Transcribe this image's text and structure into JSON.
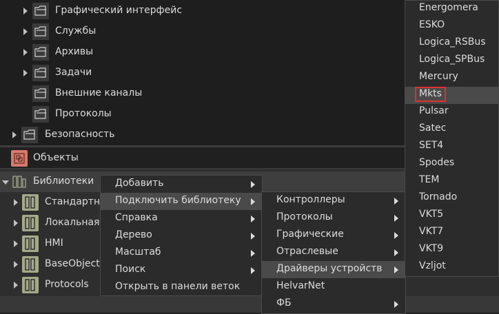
{
  "tree": {
    "items": [
      {
        "label": "Графический интерфейс"
      },
      {
        "label": "Службы"
      },
      {
        "label": "Архивы"
      },
      {
        "label": "Задачи"
      },
      {
        "label": "Внешние каналы"
      },
      {
        "label": "Протоколы"
      },
      {
        "label": "Безопасность"
      }
    ],
    "objects_label": "Объекты",
    "libraries_label": "Библиотеки",
    "libraries": [
      {
        "label": "Стандартна"
      },
      {
        "label": "Локальная"
      },
      {
        "label": "HMI"
      },
      {
        "label": "BaseObjects"
      },
      {
        "label": "Protocols"
      }
    ]
  },
  "context_menu": {
    "items": [
      {
        "label": "Добавить",
        "submenu": true
      },
      {
        "label": "Подключить библиотеку",
        "submenu": true,
        "highlighted": true
      },
      {
        "label": "Справка",
        "submenu": true
      },
      {
        "label": "Дерево",
        "submenu": true
      },
      {
        "label": "Масштаб",
        "submenu": true
      },
      {
        "label": "Поиск",
        "submenu": true
      },
      {
        "label": "Открыть в панели веток",
        "submenu": false
      }
    ]
  },
  "library_submenu": {
    "items": [
      {
        "label": "Контроллеры",
        "submenu": true
      },
      {
        "label": "Протоколы",
        "submenu": true
      },
      {
        "label": "Графические",
        "submenu": true
      },
      {
        "label": "Отраслевые",
        "submenu": true
      },
      {
        "label": "Драйверы устройств",
        "submenu": true,
        "highlighted": true
      },
      {
        "label": "HelvarNet",
        "submenu": false
      },
      {
        "label": "ФБ",
        "submenu": true
      }
    ]
  },
  "drivers_submenu": {
    "items": [
      "Energomera",
      "ESKO",
      "Logica_RSBus",
      "Logica_SPBus",
      "Mercury",
      "Mkts",
      "Pulsar",
      "Satec",
      "SET4",
      "Spodes",
      "TEM",
      "Tornado",
      "VKT5",
      "VKT7",
      "VKT9",
      "Vzljot"
    ],
    "selected": "Mkts"
  },
  "colors": {
    "highlight_box": "#e03030",
    "objects_icon": "#d8796b",
    "library_icon": "#a5a98a"
  }
}
